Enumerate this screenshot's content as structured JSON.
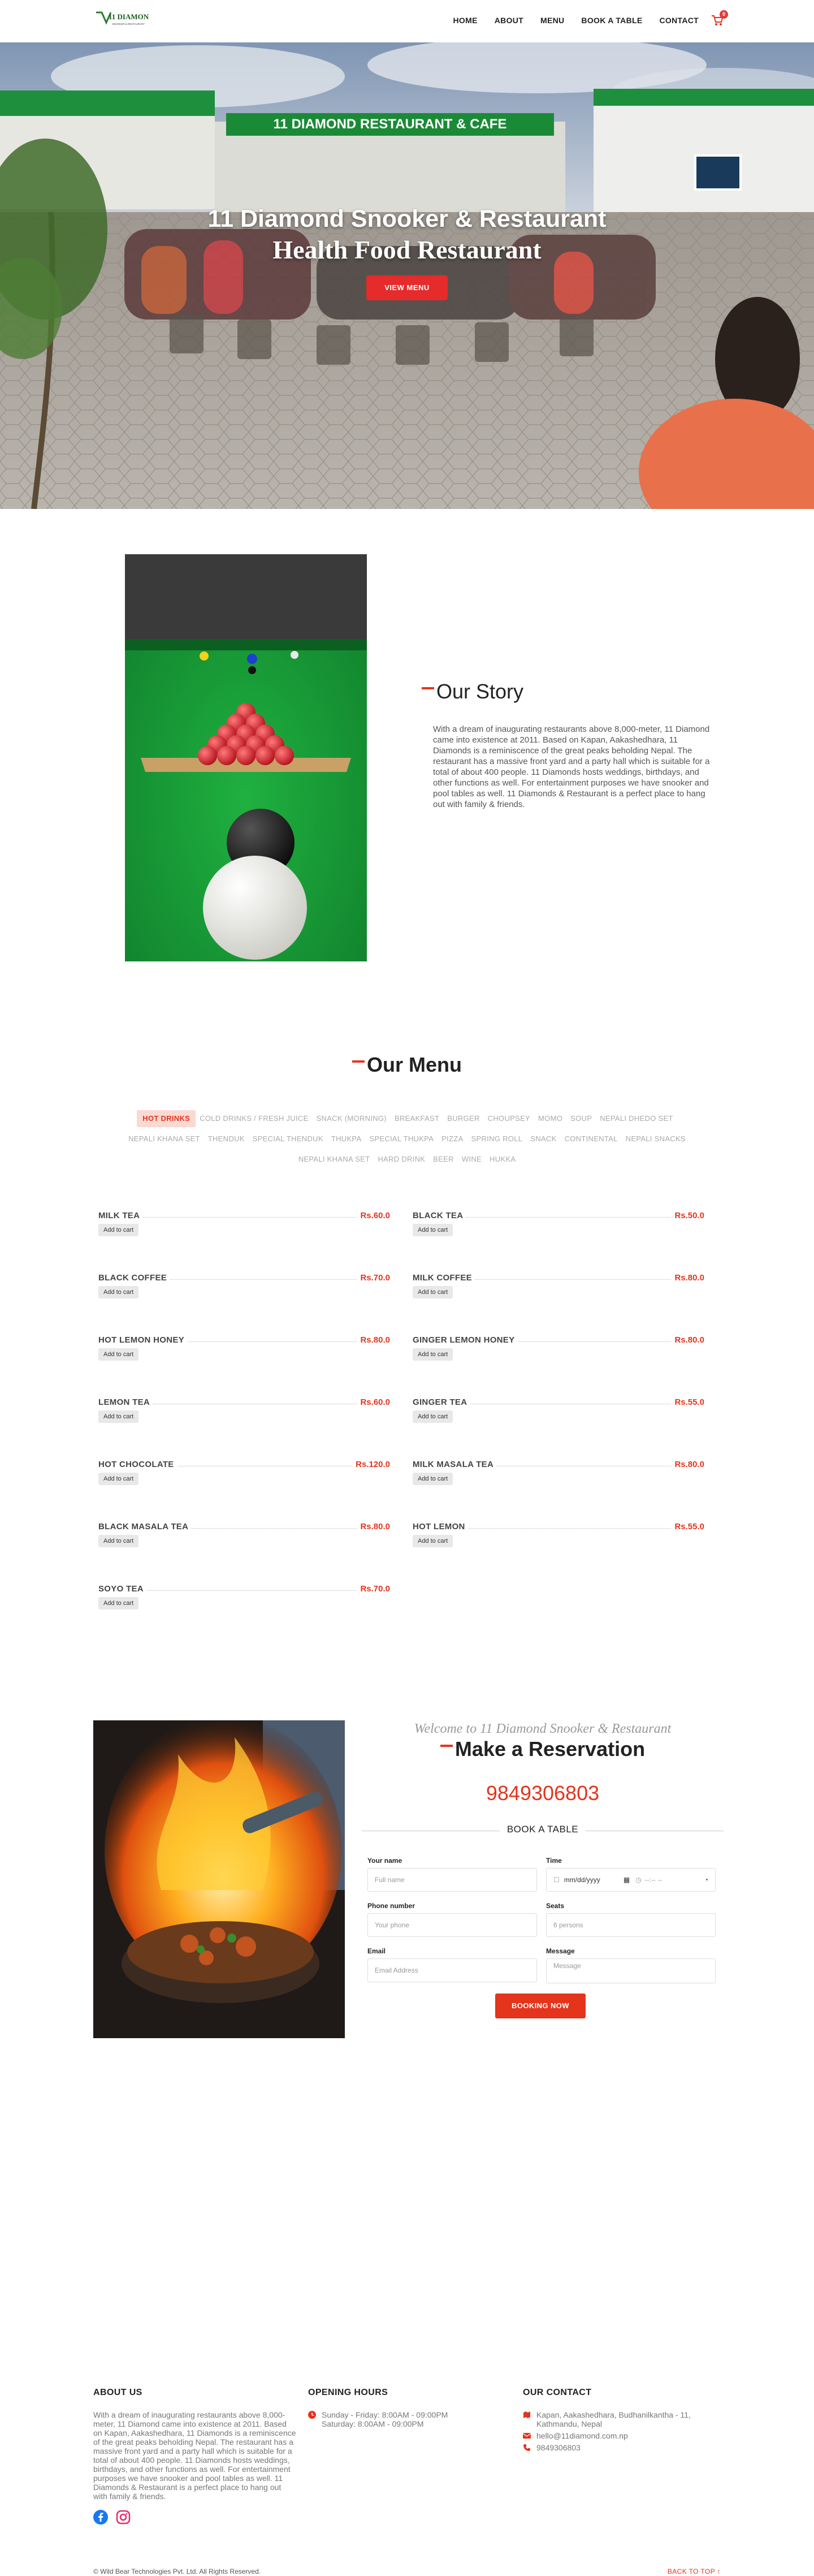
{
  "brand": {
    "logo_text": "11 DIAMOND",
    "logo_tagline": "SNOOKER & RESTAURANT",
    "accent": "#e4341c",
    "button_red": "#e52b2b"
  },
  "nav": {
    "items": [
      "HOME",
      "ABOUT",
      "MENU",
      "BOOK A TABLE",
      "CONTACT"
    ],
    "cart_count": "0"
  },
  "hero": {
    "sign_text": "11 DIAMOND RESTAURANT & CAFE",
    "title": "11 Diamond Snooker & Restaurant",
    "subtitle": "Health Food Restaurant",
    "button": "VIEW MENU"
  },
  "story": {
    "title": "Our Story",
    "text": "With a dream of inaugurating restaurants above 8,000-meter, 11 Diamond came into existence at 2011. Based on Kapan, Aakashedhara, 11 Diamonds is a reminiscence of the great peaks beholding Nepal. The restaurant has a massive front yard and a party hall which is suitable for a total of about 400 people. 11 Diamonds hosts weddings, birthdays, and other functions as well. For entertainment purposes we have snooker and pool tables as well. 11 Diamonds & Restaurant is a perfect place to hang out with family & friends."
  },
  "menu": {
    "title": "Our Menu",
    "tabs": [
      "HOT DRINKS",
      "COLD DRINKS / FRESH JUICE",
      "SNACK (MORNING)",
      "BREAKFAST",
      "BURGER",
      "CHOUPSEY",
      "MOMO",
      "SOUP",
      "NEPALI DHEDO SET",
      "NEPALI KHANA SET",
      "THENDUK",
      "SPECIAL THENDUK",
      "THUKPA",
      "SPECIAL THUKPA",
      "PIZZA",
      "SPRING ROLL",
      "SNACK",
      "CONTINENTAL",
      "NEPALI SNACKS",
      "NEPALI KHANA SET",
      "HARD DRINK",
      "BEER",
      "WINE",
      "HUKKA"
    ],
    "active_tab": "HOT DRINKS",
    "add_label": "Add to cart",
    "items": [
      {
        "name": "MILK TEA",
        "price": "Rs.60.0"
      },
      {
        "name": "BLACK TEA",
        "price": "Rs.50.0"
      },
      {
        "name": "BLACK COFFEE",
        "price": "Rs.70.0"
      },
      {
        "name": "MILK COFFEE",
        "price": "Rs.80.0"
      },
      {
        "name": "HOT LEMON HONEY",
        "price": "Rs.80.0"
      },
      {
        "name": "GINGER LEMON HONEY",
        "price": "Rs.80.0"
      },
      {
        "name": "LEMON TEA",
        "price": "Rs.60.0"
      },
      {
        "name": "GINGER TEA",
        "price": "Rs.55.0"
      },
      {
        "name": "HOT CHOCOLATE",
        "price": "Rs.120.0"
      },
      {
        "name": "MILK MASALA TEA",
        "price": "Rs.80.0"
      },
      {
        "name": "BLACK MASALA TEA",
        "price": "Rs.80.0"
      },
      {
        "name": "HOT LEMON",
        "price": "Rs.55.0"
      },
      {
        "name": "SOYO TEA",
        "price": "Rs.70.0"
      }
    ]
  },
  "reservation": {
    "welcome": "Welcome to 11 Diamond Snooker & Restaurant",
    "title": "Make a Reservation",
    "phone": "9849306803",
    "form_title": "BOOK A TABLE",
    "fields": {
      "name": {
        "label": "Your name",
        "placeholder": "Full name"
      },
      "time": {
        "label": "Time",
        "date_placeholder": "mm/dd/yyyy",
        "time_placeholder": "--:-- --"
      },
      "phone": {
        "label": "Phone number",
        "placeholder": "Your phone"
      },
      "seats": {
        "label": "Seats",
        "placeholder": "6 persons"
      },
      "email": {
        "label": "Email",
        "placeholder": "Email Address"
      },
      "message": {
        "label": "Message",
        "placeholder": "Message"
      }
    },
    "submit": "BOOKING NOW"
  },
  "footer": {
    "about": {
      "title": "ABOUT US",
      "text": "With a dream of inaugurating restaurants above 8,000-meter, 11 Diamond came into existence at 2011. Based on Kapan, Aakashedhara, 11 Diamonds is a reminiscence of the great peaks beholding Nepal. The restaurant has a massive front yard and a party hall which is suitable for a total of about 400 people. 11 Diamonds hosts weddings, birthdays, and other functions as well. For entertainment purposes we have snooker and pool tables as well. 11 Diamonds & Restaurant is a perfect place to hang out with family & friends."
    },
    "hours": {
      "title": "OPENING HOURS",
      "weekday": "Sunday - Friday: 8:00AM - 09:00PM",
      "saturday": "Saturday: 8:00AM - 09:00PM"
    },
    "contact": {
      "title": "OUR CONTACT",
      "address": "Kapan, Aakashedhara, Budhanilkantha - 11, Kathmandu, Nepal",
      "email": "hello@11diamond.com.np",
      "phone": "9849306803"
    },
    "copyright": "© Wild Bear Technologies Pvt. Ltd. All Rights Reserved.",
    "back_to_top": "BACK TO TOP ↑"
  }
}
